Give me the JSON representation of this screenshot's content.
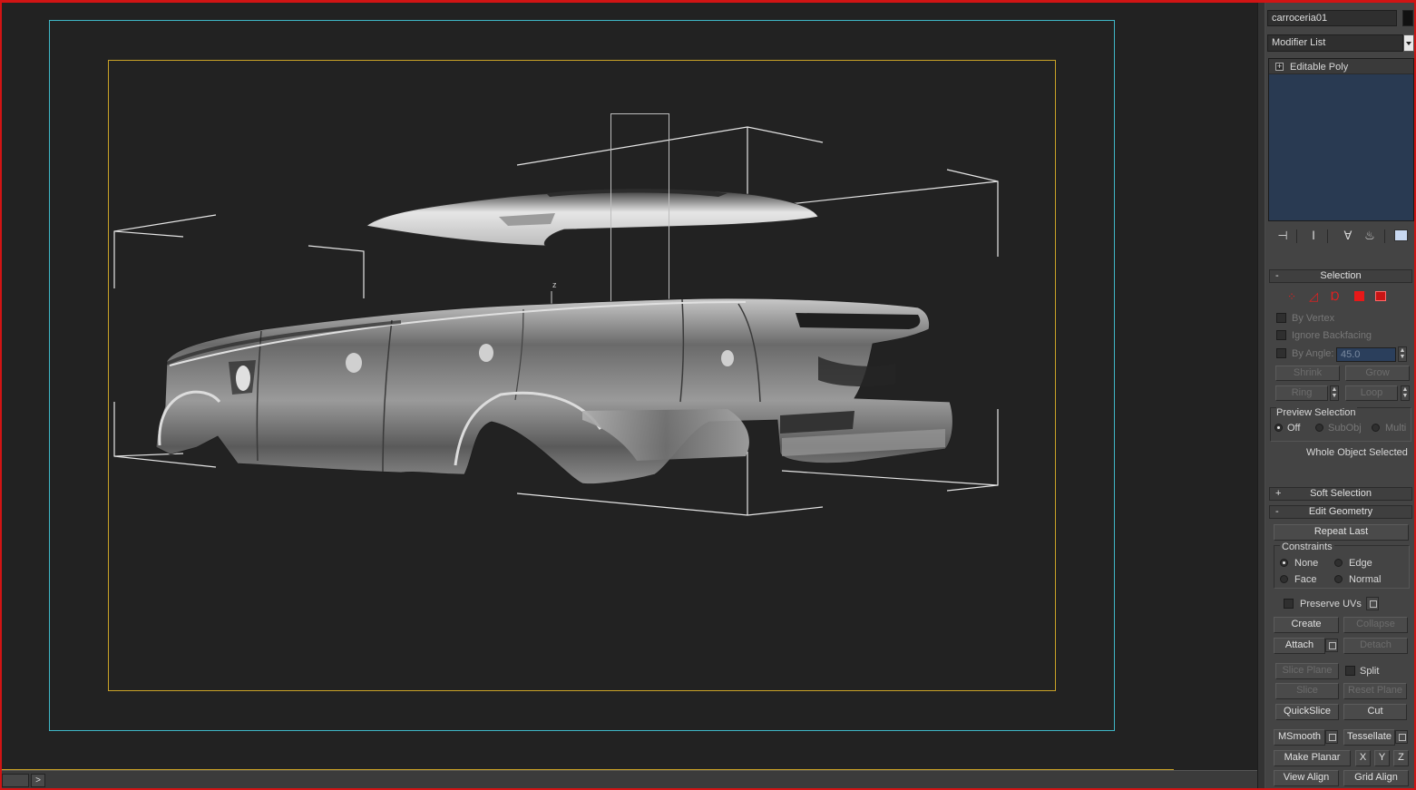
{
  "viewport": {
    "axis_label": "z"
  },
  "command_panel": {
    "object_name": "carroceria01",
    "modifier_list": "Modifier List",
    "stack_item": "Editable Poly",
    "stack_icons": [
      "pin-icon",
      "show-end-result-icon",
      "make-unique-icon",
      "remove-modifier-icon",
      "configure-modifier-sets-icon"
    ]
  },
  "selection": {
    "title": "Selection",
    "collapse_sign": "-",
    "subobject_icons": [
      "vertex-icon",
      "edge-icon",
      "border-icon",
      "polygon-icon",
      "element-icon"
    ],
    "by_vertex": "By Vertex",
    "ignore_backfacing": "Ignore Backfacing",
    "by_angle": "By Angle:",
    "angle_value": "45.0",
    "shrink": "Shrink",
    "grow": "Grow",
    "ring": "Ring",
    "loop": "Loop",
    "preview_title": "Preview Selection",
    "preview_off": "Off",
    "preview_subobj": "SubObj",
    "preview_multi": "Multi",
    "status": "Whole Object Selected"
  },
  "soft_selection": {
    "title": "Soft Selection",
    "collapse_sign": "+"
  },
  "edit_geometry": {
    "title": "Edit Geometry",
    "collapse_sign": "-",
    "repeat_last": "Repeat Last",
    "constraints_title": "Constraints",
    "none": "None",
    "edge": "Edge",
    "face": "Face",
    "normal": "Normal",
    "preserve_uvs": "Preserve UVs",
    "create": "Create",
    "collapse": "Collapse",
    "attach": "Attach",
    "detach": "Detach",
    "slice_plane": "Slice Plane",
    "split": "Split",
    "slice": "Slice",
    "reset_plane": "Reset Plane",
    "quickslice": "QuickSlice",
    "cut": "Cut",
    "msmooth": "MSmooth",
    "tessellate": "Tessellate",
    "make_planar": "Make Planar",
    "x": "X",
    "y": "Y",
    "z": "Z",
    "view_align": "View Align",
    "grid_align": "Grid Align"
  },
  "trackbar": {
    "next_glyph": ">"
  }
}
